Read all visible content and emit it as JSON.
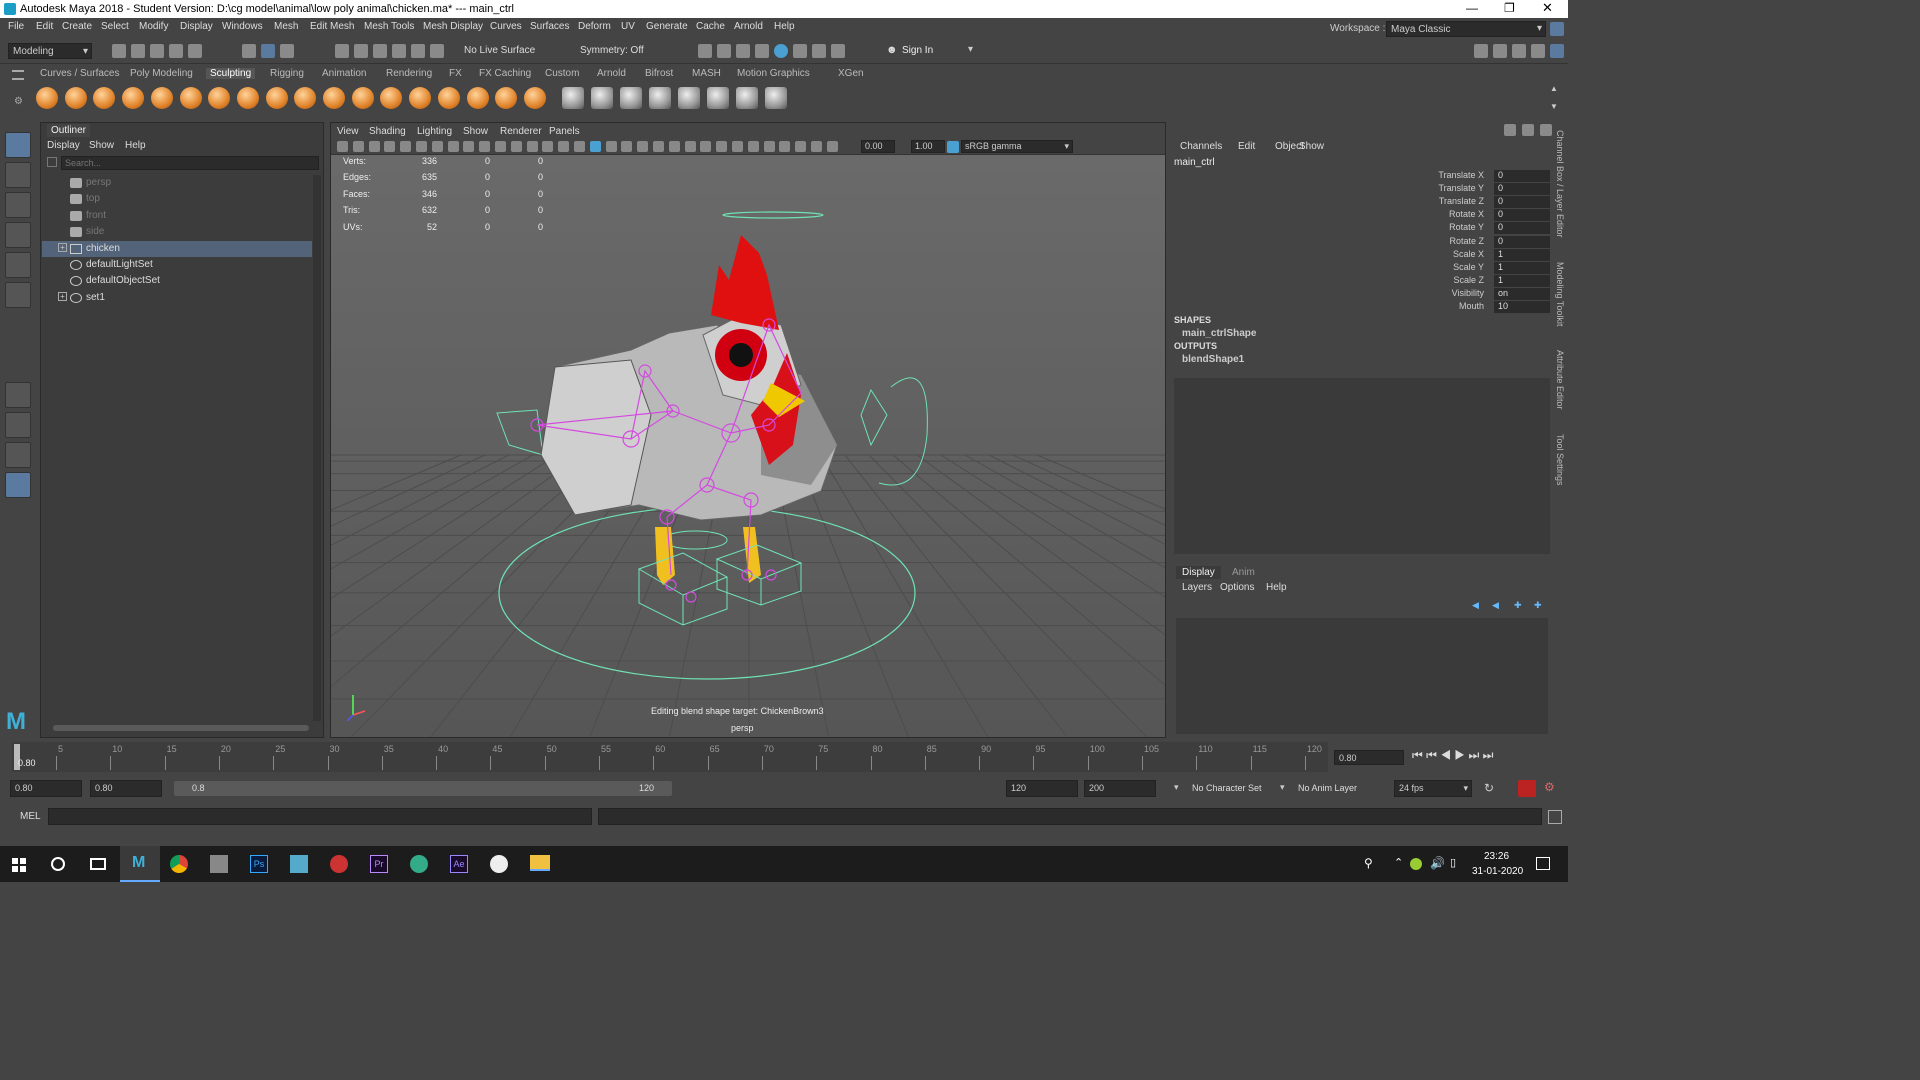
{
  "window": {
    "title": "Autodesk Maya 2018 - Student Version: D:\\cg model\\animal\\low poly animal\\chicken.ma*   ---   main_ctrl"
  },
  "menu": [
    "File",
    "Edit",
    "Create",
    "Select",
    "Modify",
    "Display",
    "Windows",
    "Mesh",
    "Edit Mesh",
    "Mesh Tools",
    "Mesh Display",
    "Curves",
    "Surfaces",
    "Deform",
    "UV",
    "Generate",
    "Cache",
    "Arnold",
    "Help"
  ],
  "workspace": {
    "label": "Workspace :",
    "value": "Maya Classic"
  },
  "status": {
    "mode": "Modeling",
    "live_surface": "No Live Surface",
    "symmetry": "Symmetry: Off",
    "sign_in": "Sign In"
  },
  "shelf_tabs": [
    "Curves / Surfaces",
    "Poly Modeling",
    "Sculpting",
    "Rigging",
    "Animation",
    "Rendering",
    "FX",
    "FX Caching",
    "Custom",
    "Arnold",
    "Bifrost",
    "MASH",
    "Motion Graphics",
    "XGen"
  ],
  "shelf_active": "Sculpting",
  "outliner": {
    "title": "Outliner",
    "menu": [
      "Display",
      "Show",
      "Help"
    ],
    "search_placeholder": "Search...",
    "items": [
      {
        "label": "persp",
        "type": "camera"
      },
      {
        "label": "top",
        "type": "camera"
      },
      {
        "label": "front",
        "type": "camera"
      },
      {
        "label": "side",
        "type": "camera"
      },
      {
        "label": "chicken",
        "type": "group",
        "selected": true
      },
      {
        "label": "defaultLightSet",
        "type": "set"
      },
      {
        "label": "defaultObjectSet",
        "type": "set"
      },
      {
        "label": "set1",
        "type": "set"
      }
    ]
  },
  "viewport": {
    "menu": [
      "View",
      "Shading",
      "Lighting",
      "Show",
      "Renderer",
      "Panels"
    ],
    "field1": "0.00",
    "field2": "1.00",
    "color_mgmt": "sRGB gamma",
    "hud": [
      {
        "label": "Verts:",
        "v1": "336",
        "v2": "0",
        "v3": "0"
      },
      {
        "label": "Edges:",
        "v1": "635",
        "v2": "0",
        "v3": "0"
      },
      {
        "label": "Faces:",
        "v1": "346",
        "v2": "0",
        "v3": "0"
      },
      {
        "label": "Tris:",
        "v1": "632",
        "v2": "0",
        "v3": "0"
      },
      {
        "label": "UVs:",
        "v1": "52",
        "v2": "0",
        "v3": "0"
      }
    ],
    "message": "Editing blend shape target: ChickenBrown3",
    "camera": "persp"
  },
  "channel_box": {
    "menu": [
      "Channels",
      "Edit",
      "Object",
      "Show"
    ],
    "object": "main_ctrl",
    "attrs": [
      {
        "name": "Translate X",
        "value": "0"
      },
      {
        "name": "Translate Y",
        "value": "0"
      },
      {
        "name": "Translate Z",
        "value": "0"
      },
      {
        "name": "Rotate X",
        "value": "0"
      },
      {
        "name": "Rotate Y",
        "value": "0"
      },
      {
        "name": "Rotate Z",
        "value": "0"
      },
      {
        "name": "Scale X",
        "value": "1"
      },
      {
        "name": "Scale Y",
        "value": "1"
      },
      {
        "name": "Scale Z",
        "value": "1"
      },
      {
        "name": "Visibility",
        "value": "on"
      },
      {
        "name": "Mouth",
        "value": "10"
      }
    ],
    "shapes_header": "SHAPES",
    "shape": "main_ctrlShape",
    "outputs_header": "OUTPUTS",
    "output": "blendShape1"
  },
  "layer_editor": {
    "tabs": [
      "Display",
      "Anim"
    ],
    "menu": [
      "Layers",
      "Options",
      "Help"
    ]
  },
  "side_tabs": [
    "Channel Box / Layer Editor",
    "Modeling Toolkit",
    "Attribute Editor",
    "Tool Settings"
  ],
  "timeline": {
    "ticks": [
      "5",
      "10",
      "15",
      "20",
      "25",
      "30",
      "35",
      "40",
      "45",
      "50",
      "55",
      "60",
      "65",
      "70",
      "75",
      "80",
      "85",
      "90",
      "95",
      "100",
      "105",
      "110",
      "115",
      "120"
    ],
    "current_frame": "0.80",
    "frame_field": "0.80"
  },
  "range": {
    "start": "0.80",
    "start2": "0.80",
    "slider_start": "0.8",
    "slider_end": "120",
    "end": "120",
    "end2": "200",
    "char_set": "No Character Set",
    "anim_layer": "No Anim Layer",
    "fps": "24 fps"
  },
  "cmd": {
    "label": "MEL"
  },
  "taskbar": {
    "time": "23:26",
    "date": "31-01-2020"
  }
}
